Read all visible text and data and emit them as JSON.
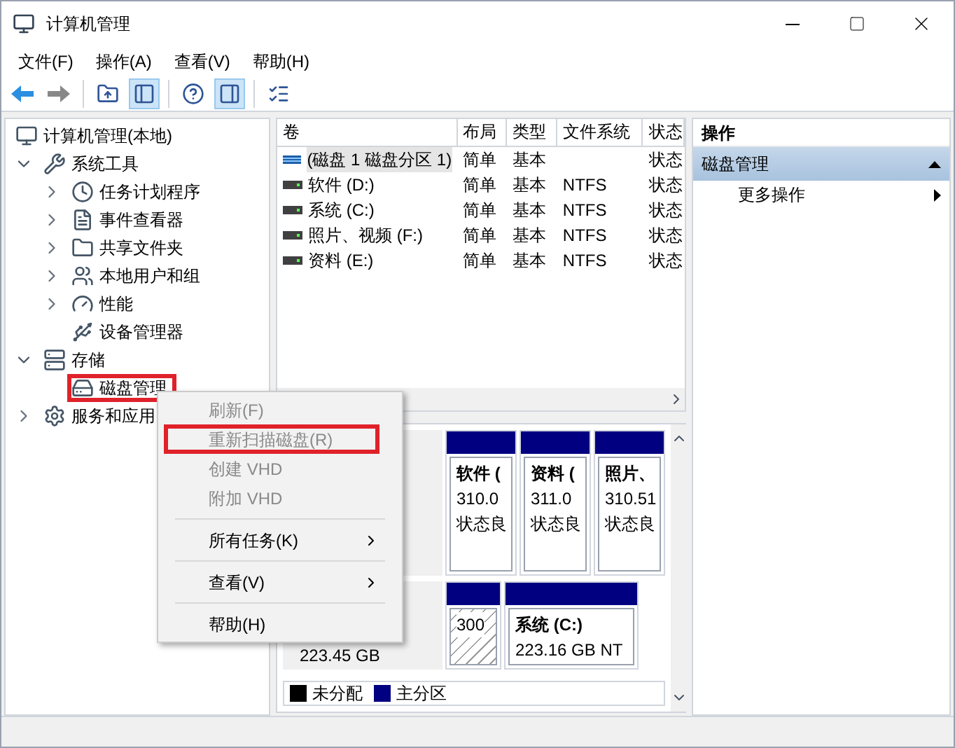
{
  "window": {
    "title": "计算机管理"
  },
  "menu_bar": [
    "文件(F)",
    "操作(A)",
    "查看(V)",
    "帮助(H)"
  ],
  "toolbar": [
    {
      "kind": "back",
      "pressed": false
    },
    {
      "kind": "forward",
      "pressed": false
    },
    {
      "kind": "separator"
    },
    {
      "kind": "up",
      "pressed": false
    },
    {
      "kind": "tree-toggle",
      "pressed": true
    },
    {
      "kind": "separator"
    },
    {
      "kind": "help",
      "pressed": false
    },
    {
      "kind": "action-toggle",
      "pressed": true
    },
    {
      "kind": "separator"
    },
    {
      "kind": "properties",
      "pressed": false
    }
  ],
  "tree": [
    {
      "label": "计算机管理(本地)",
      "kind": "root",
      "highlighted": false,
      "children": [
        {
          "label": "系统工具",
          "kind": "branch",
          "expanded": true,
          "highlighted": false,
          "children": [
            {
              "label": "任务计划程序",
              "kind": "branch",
              "expanded": false,
              "highlighted": false
            },
            {
              "label": "事件查看器",
              "kind": "branch",
              "expanded": false,
              "highlighted": false
            },
            {
              "label": "共享文件夹",
              "kind": "branch",
              "expanded": false,
              "highlighted": false
            },
            {
              "label": "本地用户和组",
              "kind": "branch",
              "expanded": false,
              "highlighted": false
            },
            {
              "label": "性能",
              "kind": "branch",
              "expanded": false,
              "highlighted": false
            },
            {
              "label": "设备管理器",
              "kind": "leaf",
              "highlighted": false
            }
          ]
        },
        {
          "label": "存储",
          "kind": "branch",
          "expanded": true,
          "highlighted": false,
          "children": [
            {
              "label": "磁盘管理",
              "kind": "leaf",
              "highlighted": true
            }
          ]
        },
        {
          "label": "服务和应用",
          "kind": "branch",
          "expanded": false,
          "highlighted": false
        }
      ]
    }
  ],
  "volumes": {
    "columns": [
      "卷",
      "布局",
      "类型",
      "文件系统",
      "状态"
    ],
    "rows": [
      {
        "volume": "(磁盘 1 磁盘分区 1)",
        "kind": "striped",
        "layout": "简单",
        "type": "基本",
        "status": "状态",
        "selected": true
      },
      {
        "volume": "软件 (D:)",
        "kind": "drive",
        "layout": "简单",
        "type": "基本",
        "fs": "NTFS",
        "status": "状态",
        "selected": false
      },
      {
        "volume": "系统 (C:)",
        "kind": "drive",
        "layout": "简单",
        "type": "基本",
        "fs": "NTFS",
        "status": "状态",
        "selected": false
      },
      {
        "volume": "照片、视频 (F:)",
        "kind": "drive",
        "layout": "简单",
        "type": "基本",
        "fs": "NTFS",
        "status": "状态",
        "selected": false
      },
      {
        "volume": "资料 (E:)",
        "kind": "drive",
        "layout": "简单",
        "type": "基本",
        "fs": "NTFS",
        "status": "状态",
        "selected": false
      }
    ]
  },
  "disks": [
    {
      "partitions": [
        {
          "kind": "primary",
          "selected": false,
          "title": "软件 (",
          "lines": [
            "310.0",
            "状态良"
          ]
        },
        {
          "kind": "primary",
          "selected": false,
          "title": "资料 (",
          "lines": [
            "311.0",
            "状态良"
          ]
        },
        {
          "kind": "primary",
          "selected": false,
          "title": "照片、",
          "lines": [
            "310.51",
            "状态良"
          ]
        }
      ]
    },
    {
      "info": [
        "223.45 GB"
      ],
      "partitions": [
        {
          "kind": "primary",
          "selected": true,
          "lines": [
            "300"
          ]
        },
        {
          "kind": "primary",
          "selected": false,
          "title": "系统 (C:)",
          "lines": [
            "223.16 GB NT"
          ]
        }
      ]
    }
  ],
  "legend": [
    {
      "label": "未分配",
      "color": "#000000"
    },
    {
      "label": "主分区",
      "color": "#000080"
    }
  ],
  "actions": {
    "title": "操作",
    "section": {
      "label": "磁盘管理",
      "expanded": true
    },
    "items": [
      {
        "label": "更多操作",
        "submenu": true
      }
    ]
  },
  "context_menu": [
    {
      "kind": "item",
      "label": "刷新(F)",
      "disabled": true,
      "highlighted": false,
      "submenu": false
    },
    {
      "kind": "item",
      "label": "重新扫描磁盘(R)",
      "disabled": true,
      "highlighted": true,
      "submenu": false
    },
    {
      "kind": "item",
      "label": "创建 VHD",
      "disabled": true,
      "highlighted": false,
      "submenu": false
    },
    {
      "kind": "item",
      "label": "附加 VHD",
      "disabled": true,
      "highlighted": false,
      "submenu": false
    },
    {
      "kind": "separator"
    },
    {
      "kind": "item",
      "label": "所有任务(K)",
      "disabled": false,
      "highlighted": false,
      "submenu": true
    },
    {
      "kind": "separator"
    },
    {
      "kind": "item",
      "label": "查看(V)",
      "disabled": false,
      "highlighted": false,
      "submenu": true
    },
    {
      "kind": "separator"
    },
    {
      "kind": "item",
      "label": "帮助(H)",
      "disabled": false,
      "highlighted": false,
      "submenu": false
    }
  ]
}
